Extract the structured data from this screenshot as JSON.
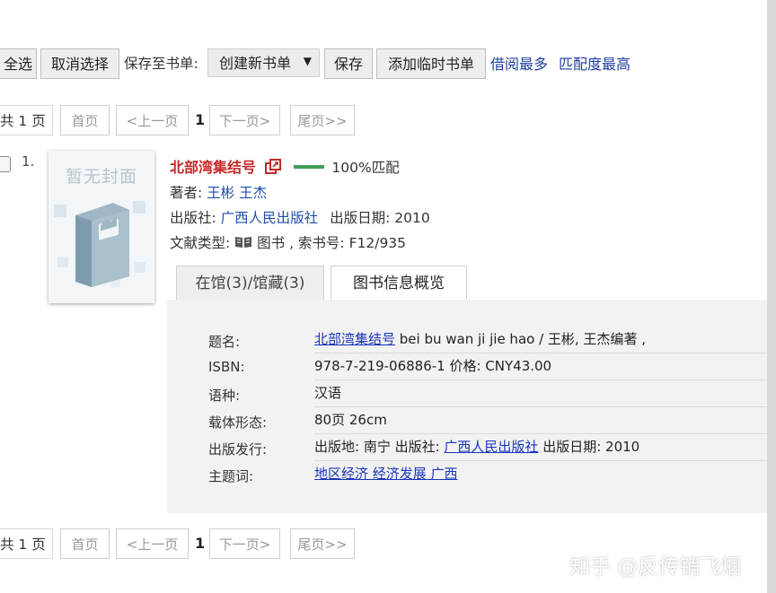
{
  "toolbar": {
    "select_all": "全选",
    "deselect": "取消选择",
    "save_to_label": "保存至书单:",
    "booklist_select": "创建新书单",
    "save": "保存",
    "add_temp": "添加临时书单",
    "sort_most_borrowed": "借阅最多",
    "sort_best_match": "匹配度最高"
  },
  "pager": {
    "total": "共 1 页",
    "first": "首页",
    "prev": "<上一页",
    "current": "1",
    "next": "下一页>",
    "last": "尾页>>"
  },
  "record": {
    "number": "1.",
    "cover_text": "暂无封面",
    "title": "北部湾集结号",
    "match_text": "100%匹配",
    "match_fraction": 1.0,
    "author_label": "著者:",
    "authors": "王彬 王杰",
    "publisher_label": "出版社:",
    "publisher": "广西人民出版社",
    "pubdate_label": "出版日期:",
    "pubdate": "2010",
    "doctype_label": "文献类型:",
    "doctype": "图书",
    "callno_label": ", 索书号:",
    "callno": "F12/935"
  },
  "tabs": {
    "holdings": "在馆(3)/馆藏(3)",
    "overview": "图书信息概览"
  },
  "details": {
    "title_label": "题名:",
    "title_link": "北部湾集结号",
    "title_rest": " bei bu wan ji jie hao / 王彬, 王杰编著 ,",
    "isbn_label": "ISBN:",
    "isbn_value": "978-7-219-06886-1 价格:  CNY43.00",
    "lang_label": "语种:",
    "lang_value": "汉语",
    "form_label": "载体形态:",
    "form_value": "80页 26cm",
    "pub_label": "出版发行:",
    "pub_place": "出版地:  南宁 出版社:  ",
    "pub_link": "广西人民出版社",
    "pub_date": " 出版日期:  2010",
    "subject_label": "主题词:",
    "subject_link": "地区经济 经济发展 广西"
  },
  "watermark": "知乎 @反传销飞烟",
  "colors": {
    "title": "#c62828",
    "link": "#1f4db0",
    "match_bar": "#3e9e56"
  }
}
